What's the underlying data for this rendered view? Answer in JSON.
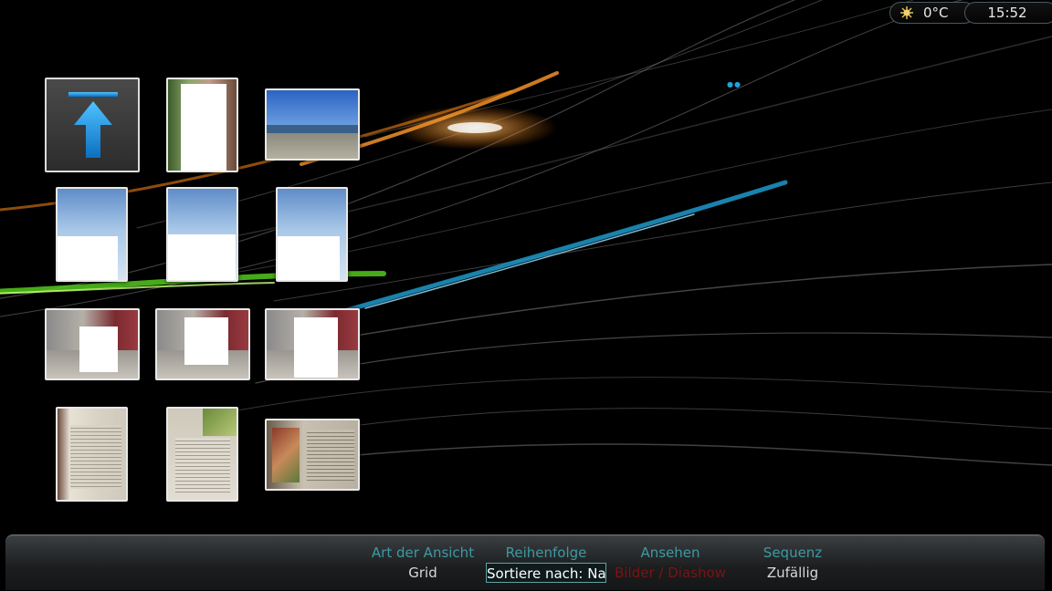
{
  "status": {
    "weather_icon": "sun-icon",
    "temperature": "0°C",
    "time": "15:52"
  },
  "grid": {
    "up_button_icon": "arrow-up-icon",
    "thumbnails": [
      {
        "name": "portrait-garden-photo"
      },
      {
        "name": "landscape-lake-photo"
      },
      {
        "name": "sky-photo-1"
      },
      {
        "name": "sky-photo-2"
      },
      {
        "name": "sky-photo-3"
      },
      {
        "name": "room-photo-1"
      },
      {
        "name": "room-photo-2"
      },
      {
        "name": "room-photo-3"
      },
      {
        "name": "book-photo-1"
      },
      {
        "name": "book-photo-2"
      },
      {
        "name": "book-photo-3"
      }
    ]
  },
  "bottom_bar": {
    "view_type": {
      "heading": "Art der Ansicht",
      "value": "Grid"
    },
    "order": {
      "heading": "Reihenfolge",
      "value": "Sortiere nach: Name"
    },
    "view": {
      "heading": "Ansehen",
      "value": "Bilder / Diashow"
    },
    "sequence": {
      "heading": "Sequenz",
      "value": "Zufällig"
    }
  },
  "colors": {
    "heading": "#3c9aa3",
    "value": "#d8d8d8",
    "accent_blue": "#1fa3d8",
    "accent_orange": "#ff8a1a",
    "accent_green": "#58d61e"
  }
}
